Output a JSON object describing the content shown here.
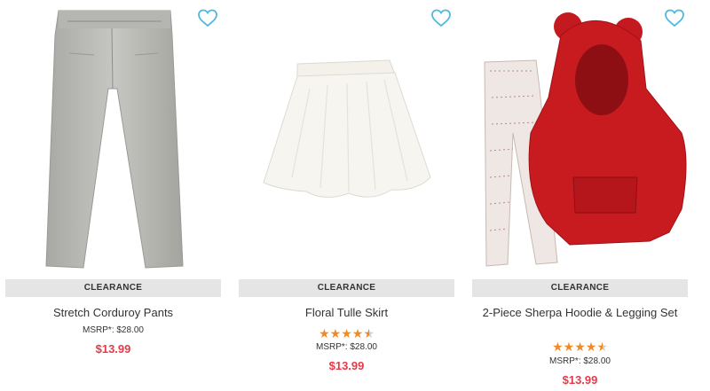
{
  "products": [
    {
      "badge": "CLEARANCE",
      "name": "Stretch Corduroy Pants",
      "rating_stars": 0,
      "msrp": "MSRP*: $28.00",
      "price": "$13.99",
      "image_icon": "gray-corduroy-pants-image"
    },
    {
      "badge": "CLEARANCE",
      "name": "Floral Tulle Skirt",
      "rating_stars": 4.5,
      "msrp": "MSRP*: $28.00",
      "price": "$13.99",
      "image_icon": "white-tulle-skirt-image"
    },
    {
      "badge": "CLEARANCE",
      "name": "2-Piece Sherpa Hoodie & Legging Set",
      "rating_stars": 4.5,
      "msrp": "MSRP*: $28.00",
      "price": "$13.99",
      "image_icon": "red-sherpa-hoodie-legging-set-image"
    }
  ],
  "colors": {
    "wishlist_icon": "#4fb8e0",
    "badge_bg": "#e5e5e5",
    "price": "#e8394b",
    "stars": "#f08a24"
  }
}
